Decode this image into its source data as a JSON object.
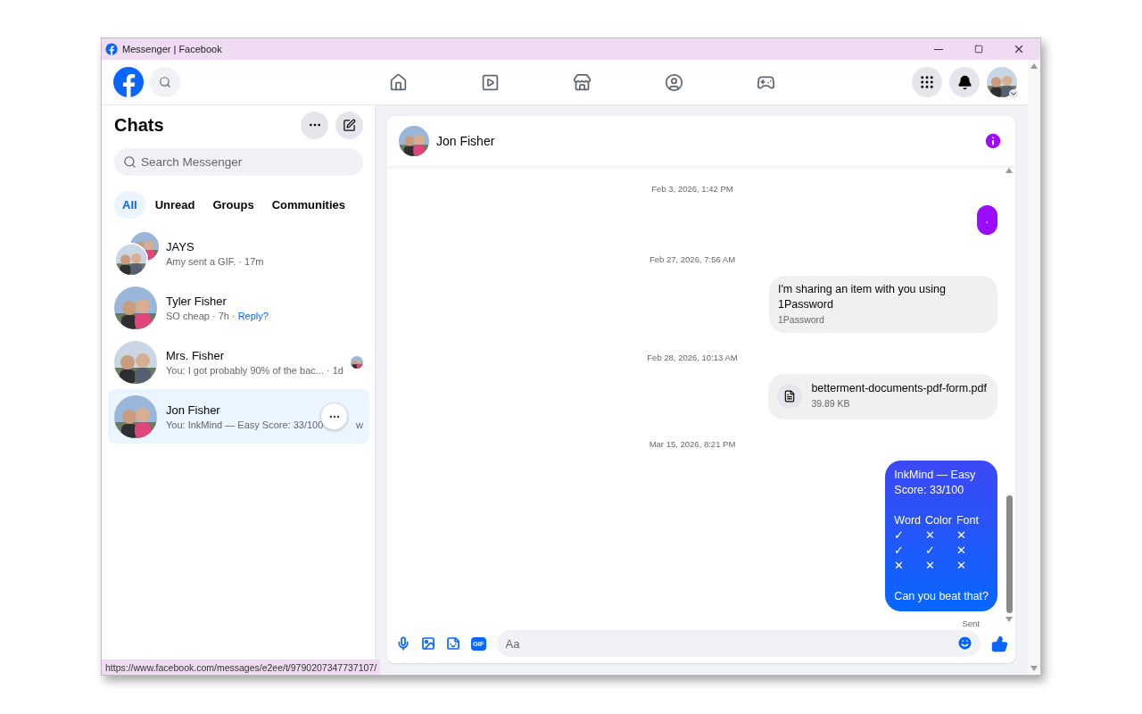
{
  "window": {
    "title": "Messenger | Facebook"
  },
  "sidebar": {
    "title": "Chats",
    "search": {
      "placeholder": "Search Messenger"
    },
    "filters": [
      {
        "label": "All",
        "selected": true
      },
      {
        "label": "Unread",
        "selected": false
      },
      {
        "label": "Groups",
        "selected": false
      },
      {
        "label": "Communities",
        "selected": false
      }
    ],
    "chats": [
      {
        "name": "JAYS",
        "kind": "group",
        "preview": "Amy sent a GIF. · 17m",
        "selected": false,
        "hovered": false,
        "seen": false
      },
      {
        "name": "Tyler Fisher",
        "kind": "single",
        "preview": "SO cheap · 7h ·",
        "link": "Reply?",
        "selected": false,
        "hovered": false,
        "seen": false
      },
      {
        "name": "Mrs. Fisher",
        "kind": "single",
        "preview": "You: I got probably 90% of the bac... · 1d",
        "selected": false,
        "hovered": false,
        "seen": true
      },
      {
        "name": "Jon Fisher",
        "kind": "single",
        "preview": "You: InkMind — Easy Score: 33/100",
        "time": "w",
        "selected": true,
        "hovered": true,
        "seen": false
      }
    ]
  },
  "conversation": {
    "name": "Jon Fisher",
    "messages": [
      {
        "kind": "timestamp",
        "text": "Feb 3, 2026, 1:42 PM"
      },
      {
        "kind": "sent",
        "text": ".",
        "color": "#9b0cff"
      },
      {
        "kind": "timestamp",
        "text": "Feb 27, 2026, 7:56 AM"
      },
      {
        "kind": "shared",
        "text": "I'm sharing an item with you using 1Password",
        "source": "1Password"
      },
      {
        "kind": "timestamp",
        "text": "Feb 28, 2026, 10:13 AM"
      },
      {
        "kind": "file",
        "name": "betterment-documents-pdf-form.pdf",
        "size": "39.89 KB"
      },
      {
        "kind": "timestamp",
        "text": "Mar 15, 2026, 8:21 PM"
      },
      {
        "kind": "score",
        "lines": [
          "InkMind — Easy",
          "Score: 33/100"
        ],
        "columns": [
          "Word",
          "Color",
          "Font"
        ],
        "rows": [
          [
            "✓",
            "✕",
            "✕"
          ],
          [
            "✓",
            "✓",
            "✕"
          ],
          [
            "✕",
            "✕",
            "✕"
          ]
        ],
        "footer": "Can you beat that?",
        "status": "Sent"
      }
    ]
  },
  "composer": {
    "placeholder": "Aa",
    "gif": "GIF"
  },
  "status_bar": {
    "url": "https://www.facebook.com/messages/e2ee/t/9790207347737107/"
  }
}
